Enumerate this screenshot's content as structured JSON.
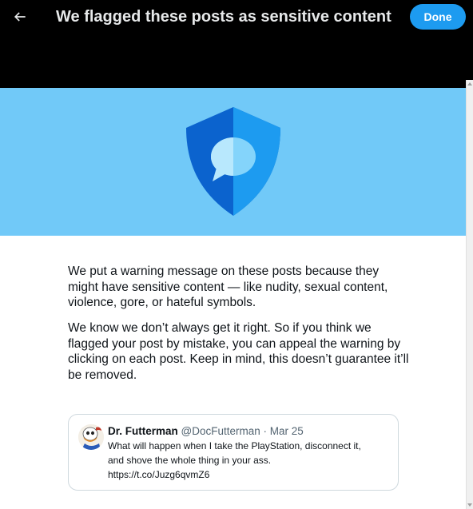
{
  "header": {
    "title": "We flagged these posts as sensitive content",
    "back_icon": "arrow-left-icon",
    "done_label": "Done"
  },
  "banner": {
    "icon": "shield-chat-icon",
    "background": "#71c9f8"
  },
  "body": {
    "paragraph1": "We put a warning message on these posts because they might have sensitive content — like nudity, sexual content, violence, gore, or hateful symbols.",
    "paragraph2": "We know we don’t always get it right. So if you think we flagged your post by mistake, you can appeal the warning by clicking on each post. Keep in mind, this doesn’t guarantee it’ll be removed."
  },
  "tweet": {
    "author_name": "Dr. Futterman",
    "author_handle": "@DocFutterman",
    "separator": "·",
    "date": "Mar 25",
    "text": "What will happen when I take the PlayStation, disconnect it,\nand shove the whole thing in your ass.\nhttps://t.co/Juzg6qvmZ6"
  },
  "colors": {
    "accent": "#1d9bf0",
    "header_bg": "#000000",
    "banner_bg": "#71c9f8",
    "shield_dark": "#0b63ce",
    "shield_light": "#1d9bf0"
  }
}
